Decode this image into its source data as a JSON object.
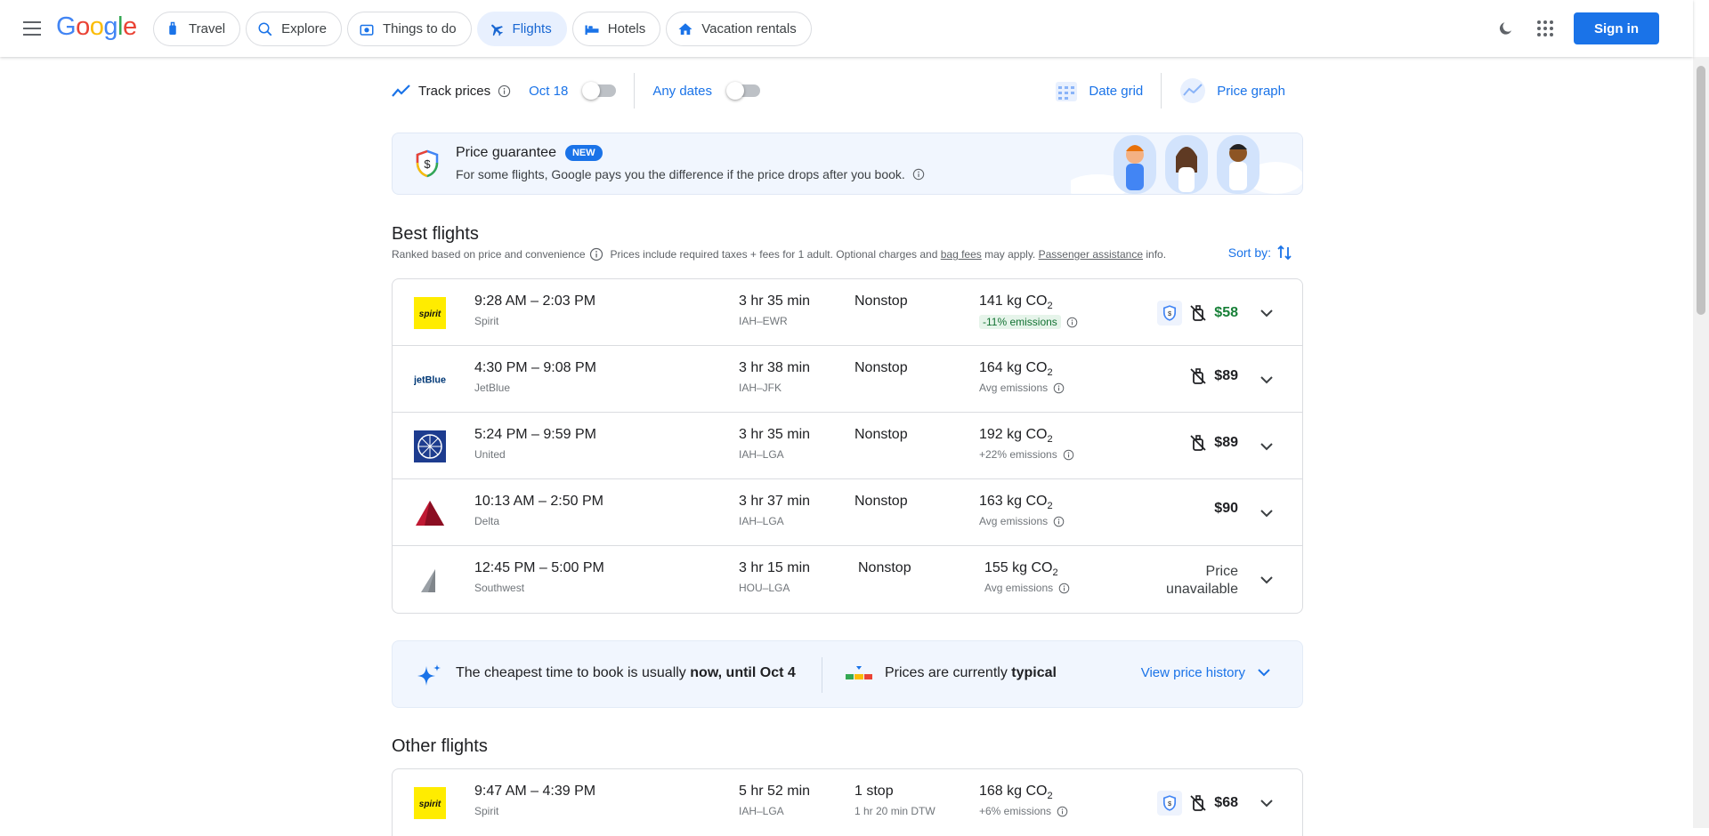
{
  "header": {
    "logo": "Google",
    "nav": [
      {
        "label": "Travel",
        "icon": "luggage-icon"
      },
      {
        "label": "Explore",
        "icon": "explore-icon"
      },
      {
        "label": "Things to do",
        "icon": "camera-icon"
      },
      {
        "label": "Flights",
        "icon": "plane-icon",
        "active": true
      },
      {
        "label": "Hotels",
        "icon": "bed-icon"
      },
      {
        "label": "Vacation rentals",
        "icon": "house-icon"
      }
    ],
    "signin": "Sign in"
  },
  "controls": {
    "track_prices": "Track prices",
    "track_date": "Oct 18",
    "any_dates": "Any dates",
    "date_grid": "Date grid",
    "price_graph": "Price graph"
  },
  "guarantee": {
    "title": "Price guarantee",
    "badge": "NEW",
    "description": "For some flights, Google pays you the difference if the price drops after you book."
  },
  "best": {
    "title": "Best flights",
    "ranked": "Ranked based on price and convenience",
    "prices_note_1": "Prices include required taxes + fees for 1 adult. Optional charges and",
    "bag_fees": "bag fees",
    "prices_note_2": "may apply.",
    "passenger": "Passenger assistance",
    "prices_note_3": "info.",
    "sort_by": "Sort by:"
  },
  "best_flights": [
    {
      "times": "9:28 AM – 2:03 PM",
      "airline": "Spirit",
      "duration": "3 hr 35 min",
      "route": "IAH–EWR",
      "stops": "Nonstop",
      "stops_sub": "",
      "co2": "141 kg CO",
      "emissions": "-11% emissions",
      "emissions_good": true,
      "price": "$58",
      "price_green": true,
      "guarantee": true,
      "no_bag": true,
      "logo": "spirit"
    },
    {
      "times": "4:30 PM – 9:08 PM",
      "airline": "JetBlue",
      "duration": "3 hr 38 min",
      "route": "IAH–JFK",
      "stops": "Nonstop",
      "stops_sub": "",
      "co2": "164 kg CO",
      "emissions": "Avg emissions",
      "emissions_good": false,
      "price": "$89",
      "price_green": false,
      "guarantee": false,
      "no_bag": true,
      "logo": "jetblue"
    },
    {
      "times": "5:24 PM – 9:59 PM",
      "airline": "United",
      "duration": "3 hr 35 min",
      "route": "IAH–LGA",
      "stops": "Nonstop",
      "stops_sub": "",
      "co2": "192 kg CO",
      "emissions": "+22% emissions",
      "emissions_good": false,
      "price": "$89",
      "price_green": false,
      "guarantee": false,
      "no_bag": true,
      "logo": "united"
    },
    {
      "times": "10:13 AM – 2:50 PM",
      "airline": "Delta",
      "duration": "3 hr 37 min",
      "route": "IAH–LGA",
      "stops": "Nonstop",
      "stops_sub": "",
      "co2": "163 kg CO",
      "emissions": "Avg emissions",
      "emissions_good": false,
      "price": "$90",
      "price_green": false,
      "guarantee": false,
      "no_bag": false,
      "logo": "delta"
    },
    {
      "times": "12:45 PM – 5:00 PM",
      "airline": "Southwest",
      "duration": "3 hr 15 min",
      "route": "HOU–LGA",
      "stops": "Nonstop",
      "stops_sub": "",
      "co2": "155 kg CO",
      "emissions": "Avg emissions",
      "emissions_good": false,
      "price": "",
      "price_unavailable_1": "Price",
      "price_unavailable_2": "unavailable",
      "guarantee": false,
      "no_bag": false,
      "logo": "southwest"
    }
  ],
  "insight": {
    "cheapest_1": "The cheapest time to book is usually",
    "cheapest_2": "now, until Oct 4",
    "typical_1": "Prices are currently",
    "typical_2": "typical",
    "view_history": "View price history"
  },
  "other": {
    "title": "Other flights"
  },
  "other_flights": [
    {
      "times": "9:47 AM – 4:39 PM",
      "airline": "Spirit",
      "duration": "5 hr 52 min",
      "route": "IAH–LGA",
      "stops": "1 stop",
      "stops_sub": "1 hr 20 min DTW",
      "co2": "168 kg CO",
      "emissions": "+6% emissions",
      "emissions_good": false,
      "price": "$68",
      "price_green": false,
      "guarantee": true,
      "no_bag": true,
      "logo": "spirit"
    }
  ],
  "colors": {
    "accent": "#1a73e8",
    "good": "#188038",
    "spirit": "#ffec00",
    "delta": "#c01933",
    "united": "#1d3c8f"
  }
}
